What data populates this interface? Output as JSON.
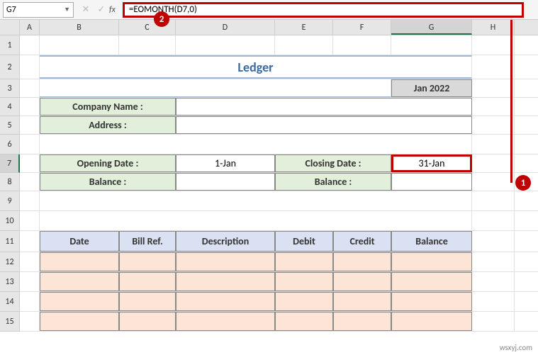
{
  "nameBox": "G7",
  "formula": "=EOMONTH(D7,0)",
  "fxLabel": "fx",
  "columns": [
    "A",
    "B",
    "C",
    "D",
    "E",
    "F",
    "G",
    "H"
  ],
  "rows": [
    "1",
    "2",
    "3",
    "4",
    "5",
    "6",
    "7",
    "8",
    "9",
    "10",
    "11",
    "12",
    "13",
    "14",
    "15"
  ],
  "activeCol": "G",
  "activeRow": "7",
  "badge1": "1",
  "badge2": "2",
  "content": {
    "title": "Ledger",
    "month": "Jan 2022",
    "companyLabel": "Company Name :",
    "addressLabel": "Address :",
    "openDateLabel": "Opening Date :",
    "openDateVal": "1-Jan",
    "closeDateLabel": "Closing Date :",
    "closeDateVal": "31-Jan",
    "balanceLabel1": "Balance :",
    "balanceLabel2": "Balance :",
    "th": {
      "date": "Date",
      "billref": "Bill Ref.",
      "desc": "Description",
      "debit": "Debit",
      "credit": "Credit",
      "balance": "Balance"
    }
  },
  "watermark": "wsxyj.com"
}
